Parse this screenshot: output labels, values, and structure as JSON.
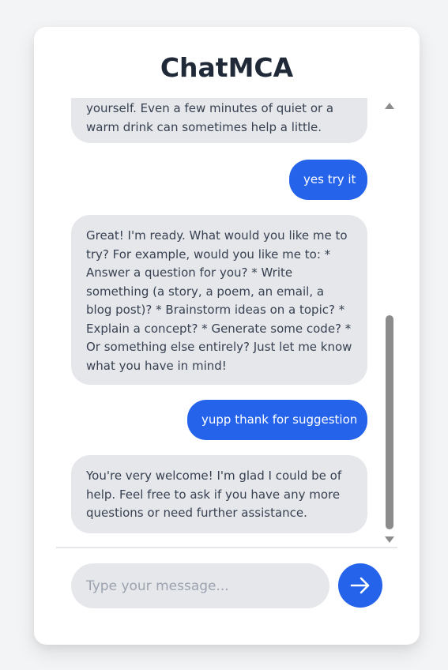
{
  "app": {
    "title": "ChatMCA"
  },
  "messages": [
    {
      "role": "bot",
      "text": "yourself. Even a few minutes of quiet or a warm drink can sometimes help a little."
    },
    {
      "role": "user",
      "text": "yes try it"
    },
    {
      "role": "bot",
      "text": "Great! I'm ready. What would you like me to try? For example, would you like me to: * Answer a question for you? * Write something (a story, a poem, an email, a blog post)? * Brainstorm ideas on a topic? * Explain a concept? * Generate some code? * Or something else entirely? Just let me know what you have in mind!"
    },
    {
      "role": "user",
      "text": "yupp thank for suggestion"
    },
    {
      "role": "bot",
      "text": "You're very welcome! I'm glad I could be of help. Feel free to ask if you have any more questions or need further assistance."
    }
  ],
  "composer": {
    "placeholder": "Type your message...",
    "send_icon": "arrow-right-icon"
  },
  "colors": {
    "accent": "#2563eb",
    "bot_bubble": "#e5e7eb",
    "page_bg": "#f3f4f6",
    "title_text": "#1f2937"
  }
}
